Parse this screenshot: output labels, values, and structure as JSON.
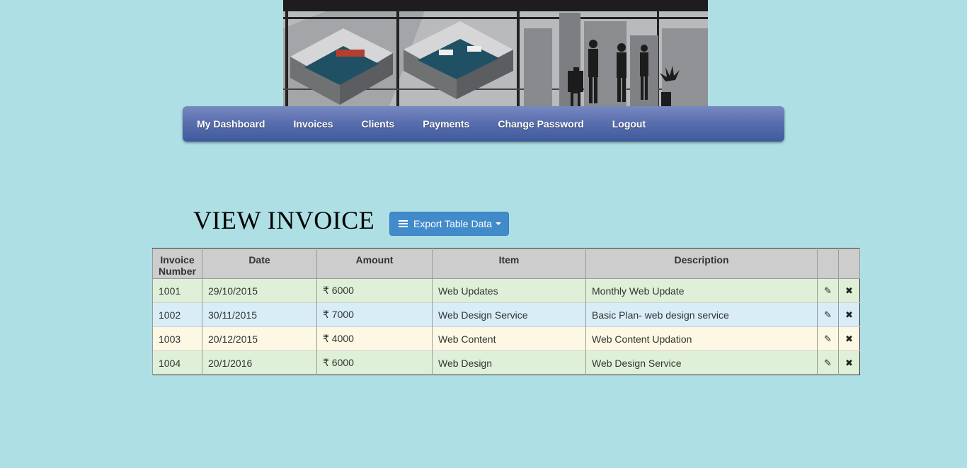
{
  "nav": {
    "items": [
      {
        "label": "My Dashboard"
      },
      {
        "label": "Invoices"
      },
      {
        "label": "Clients"
      },
      {
        "label": "Payments"
      },
      {
        "label": "Change Password"
      },
      {
        "label": "Logout"
      }
    ]
  },
  "page": {
    "title": "VIEW INVOICE",
    "export_label": "Export Table Data"
  },
  "table": {
    "headers": [
      "Invoice Number",
      "Date",
      "Amount",
      "Item",
      "Description",
      "",
      ""
    ],
    "rows": [
      {
        "number": "1001",
        "date": "29/10/2015",
        "amount": "₹ 6000",
        "item": "Web Updates",
        "description": "Monthly Web Update",
        "style": "green"
      },
      {
        "number": "1002",
        "date": "30/11/2015",
        "amount": "₹ 7000",
        "item": "Web Design Service",
        "description": "Basic Plan- web design service",
        "style": "blue"
      },
      {
        "number": "1003",
        "date": "20/12/2015",
        "amount": "₹ 4000",
        "item": "Web Content",
        "description": "Web Content Updation",
        "style": "yellow"
      },
      {
        "number": "1004",
        "date": "20/1/2016",
        "amount": "₹ 6000",
        "item": "Web Design",
        "description": "Web Design Service",
        "style": "green"
      }
    ],
    "edit_icon": "pencil-icon",
    "delete_icon": "remove-icon"
  },
  "colors": {
    "background": "#aedfe4",
    "nav": "#5a6fae",
    "button": "#428bca",
    "row_green": "#dff0d8",
    "row_blue": "#d9edf7",
    "row_yellow": "#fcf8e3"
  }
}
